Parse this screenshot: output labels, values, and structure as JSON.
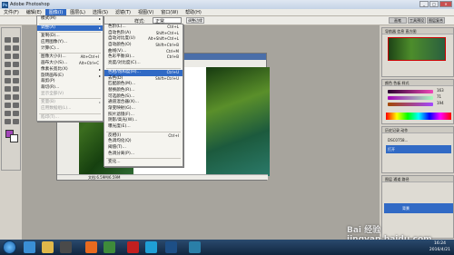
{
  "title_bar": {
    "app_icon": "Ps",
    "title": "Adobe Photoshop"
  },
  "menubar": {
    "items": [
      "文件(F)",
      "编辑(E)",
      "图像(I)",
      "图层(L)",
      "选择(S)",
      "滤镜(T)",
      "视图(V)",
      "窗口(W)",
      "帮助(H)"
    ],
    "active_index": 2
  },
  "options_bar": {
    "style_label": "样式:",
    "style_value": "正常",
    "button": "调整边缘",
    "tabs": [
      "画笔",
      "工具预设",
      "图层复合"
    ]
  },
  "image_menu": {
    "items": [
      {
        "label": "模式(M)",
        "arrow": true
      },
      {
        "sep": true
      },
      {
        "label": "调整(A)",
        "arrow": true,
        "hl": true
      },
      {
        "sep": true
      },
      {
        "label": "复制(D)..."
      },
      {
        "label": "应用图像(Y)..."
      },
      {
        "label": "计算(C)..."
      },
      {
        "sep": true
      },
      {
        "label": "图像大小(I)...",
        "sc": "Alt+Ctrl+I"
      },
      {
        "label": "画布大小(S)...",
        "sc": "Alt+Ctrl+C"
      },
      {
        "label": "像素长宽比(X)",
        "arrow": true
      },
      {
        "label": "旋转画布(E)",
        "arrow": true
      },
      {
        "label": "裁剪(P)"
      },
      {
        "label": "裁切(R)..."
      },
      {
        "label": "显示全部(V)",
        "dis": true
      },
      {
        "sep": true
      },
      {
        "label": "变量(B)",
        "arrow": true,
        "dis": true
      },
      {
        "label": "应用数据组(L)...",
        "dis": true
      },
      {
        "sep": true
      },
      {
        "label": "陷印(T)...",
        "dis": true
      }
    ]
  },
  "adjust_menu": {
    "items": [
      {
        "label": "色阶(L)...",
        "sc": "Ctrl+L"
      },
      {
        "label": "自动色阶(A)",
        "sc": "Shift+Ctrl+L"
      },
      {
        "label": "自动对比度(U)",
        "sc": "Alt+Shift+Ctrl+L"
      },
      {
        "label": "自动颜色(O)",
        "sc": "Shift+Ctrl+B"
      },
      {
        "label": "曲线(V)...",
        "sc": "Ctrl+M"
      },
      {
        "label": "色彩平衡(B)...",
        "sc": "Ctrl+B"
      },
      {
        "label": "亮度/对比度(C)..."
      },
      {
        "sep": true
      },
      {
        "label": "色相/饱和度(H)...",
        "sc": "Ctrl+U",
        "hl": true
      },
      {
        "label": "去色(D)",
        "sc": "Shift+Ctrl+U"
      },
      {
        "label": "匹配颜色(M)..."
      },
      {
        "label": "替换颜色(R)..."
      },
      {
        "label": "可选颜色(S)..."
      },
      {
        "label": "通道混合器(X)..."
      },
      {
        "label": "渐变映射(G)..."
      },
      {
        "label": "照片滤镜(F)..."
      },
      {
        "label": "阴影/高光(W)..."
      },
      {
        "label": "曝光度(E)..."
      },
      {
        "sep": true
      },
      {
        "label": "反相(I)",
        "sc": "Ctrl+I"
      },
      {
        "label": "色调均化(Q)"
      },
      {
        "label": "阈值(T)..."
      },
      {
        "label": "色调分离(P)..."
      },
      {
        "sep": true
      },
      {
        "label": "变化..."
      }
    ]
  },
  "document": {
    "status": "文档:6.59M/6.59M"
  },
  "panels": {
    "navigator_tabs": "导航器  信息  直方图",
    "color_tabs": "颜色  色板  样式",
    "color_values": [
      "163",
      "71",
      "194"
    ],
    "history_tabs": "历史记录  动作",
    "history_items": [
      "DSC0758...",
      "打开"
    ],
    "layers_tabs": "图层  通道  路径",
    "layer_name": "背景"
  },
  "taskbar": {
    "time": "16:24",
    "date": "2016/4/21"
  },
  "watermark": "Bai 经验 jingyan.baidu.com",
  "colors": {
    "foreground": "#a347b9",
    "highlight": "#316ac5"
  }
}
